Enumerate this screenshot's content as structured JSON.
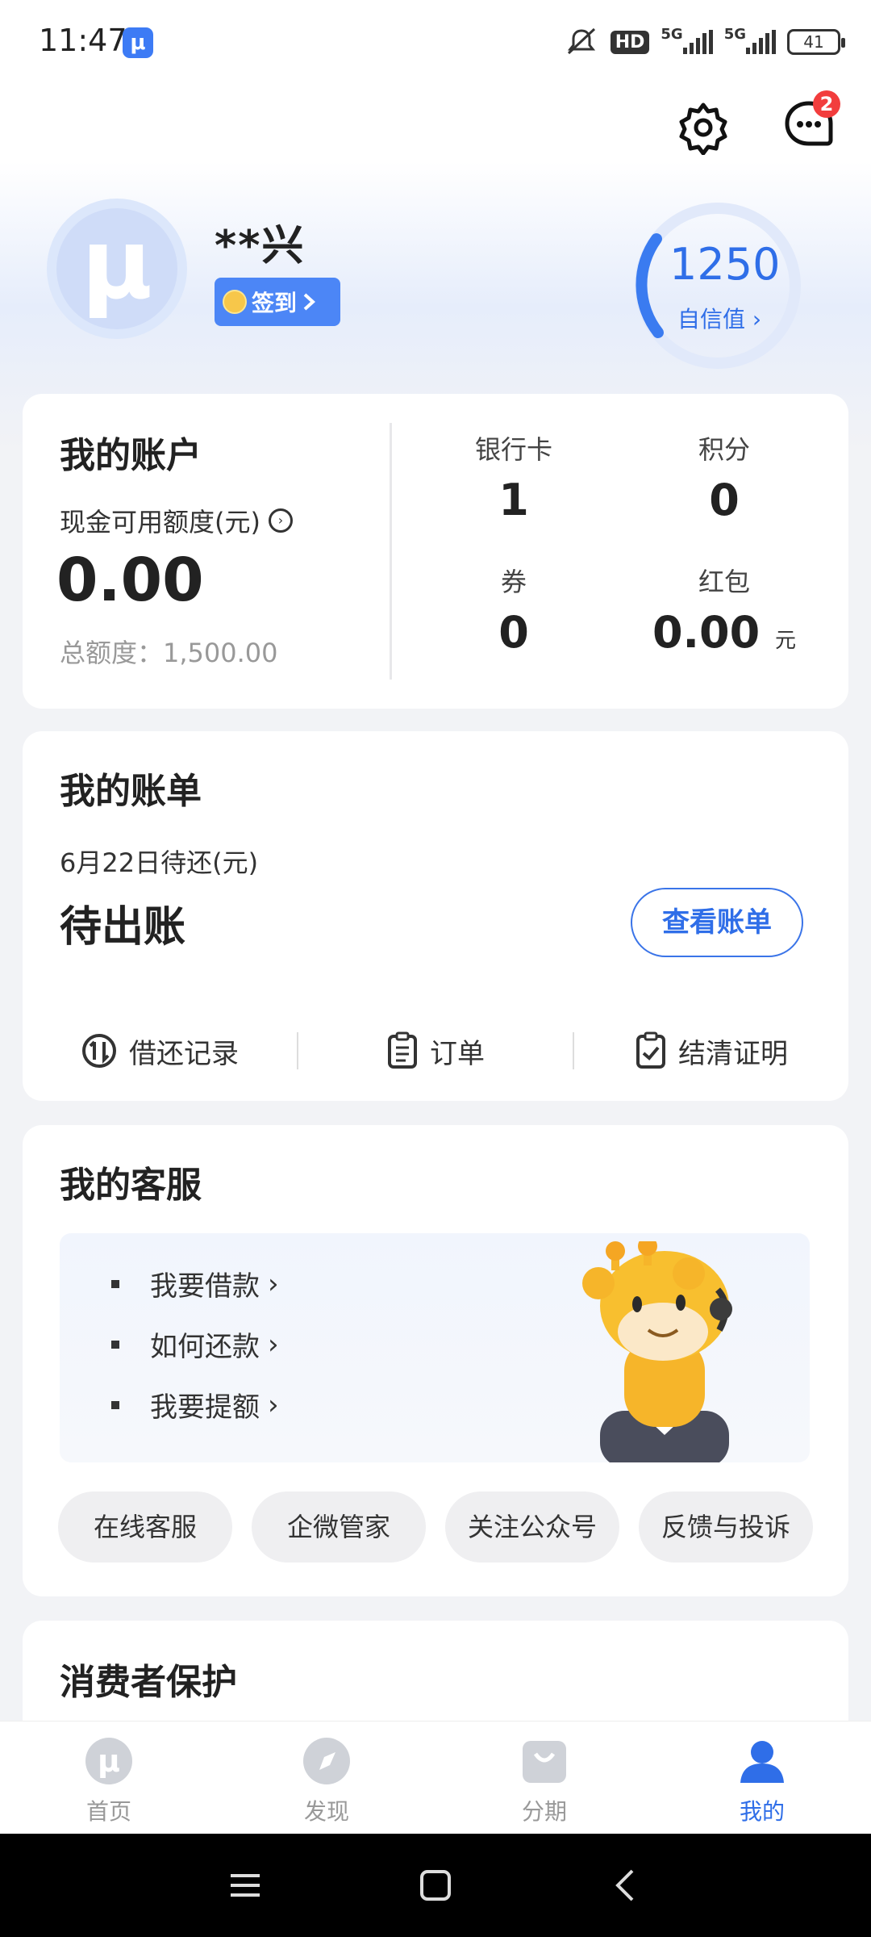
{
  "status_bar": {
    "time": "11:47",
    "app_icon": "μ",
    "hd": "HD",
    "net1": "5G",
    "net2": "5G",
    "battery": "41"
  },
  "header": {
    "message_badge": "2"
  },
  "profile": {
    "username": "**兴",
    "avatar_glyph": "μ",
    "signin_label": "签到",
    "credit_score": "1250",
    "credit_label": "自信值"
  },
  "account": {
    "title": "我的账户",
    "available_label": "现金可用额度(元)",
    "available_amount": "0.00",
    "total_label": "总额度：1,500.00",
    "stats": [
      {
        "label": "银行卡",
        "value": "1",
        "unit": ""
      },
      {
        "label": "积分",
        "value": "0",
        "unit": ""
      },
      {
        "label": "券",
        "value": "0",
        "unit": ""
      },
      {
        "label": "红包",
        "value": "0.00",
        "unit": "元"
      }
    ]
  },
  "bill": {
    "title": "我的账单",
    "due_label": "6月22日待还(元)",
    "status": "待出账",
    "view_button": "查看账单",
    "links": [
      {
        "label": "借还记录"
      },
      {
        "label": "订单"
      },
      {
        "label": "结清证明"
      }
    ]
  },
  "service": {
    "title": "我的客服",
    "items": [
      {
        "label": "我要借款"
      },
      {
        "label": "如何还款"
      },
      {
        "label": "我要提额"
      }
    ],
    "chips": [
      {
        "label": "在线客服"
      },
      {
        "label": "企微管家"
      },
      {
        "label": "关注公众号"
      },
      {
        "label": "反馈与投诉"
      }
    ]
  },
  "protection": {
    "title": "消费者保护"
  },
  "nav": {
    "items": [
      {
        "label": "首页",
        "icon": "home-icon"
      },
      {
        "label": "发现",
        "icon": "compass-icon"
      },
      {
        "label": "分期",
        "icon": "bag-icon"
      },
      {
        "label": "我的",
        "icon": "person-icon"
      }
    ],
    "active_color": "#2f6ee8"
  }
}
